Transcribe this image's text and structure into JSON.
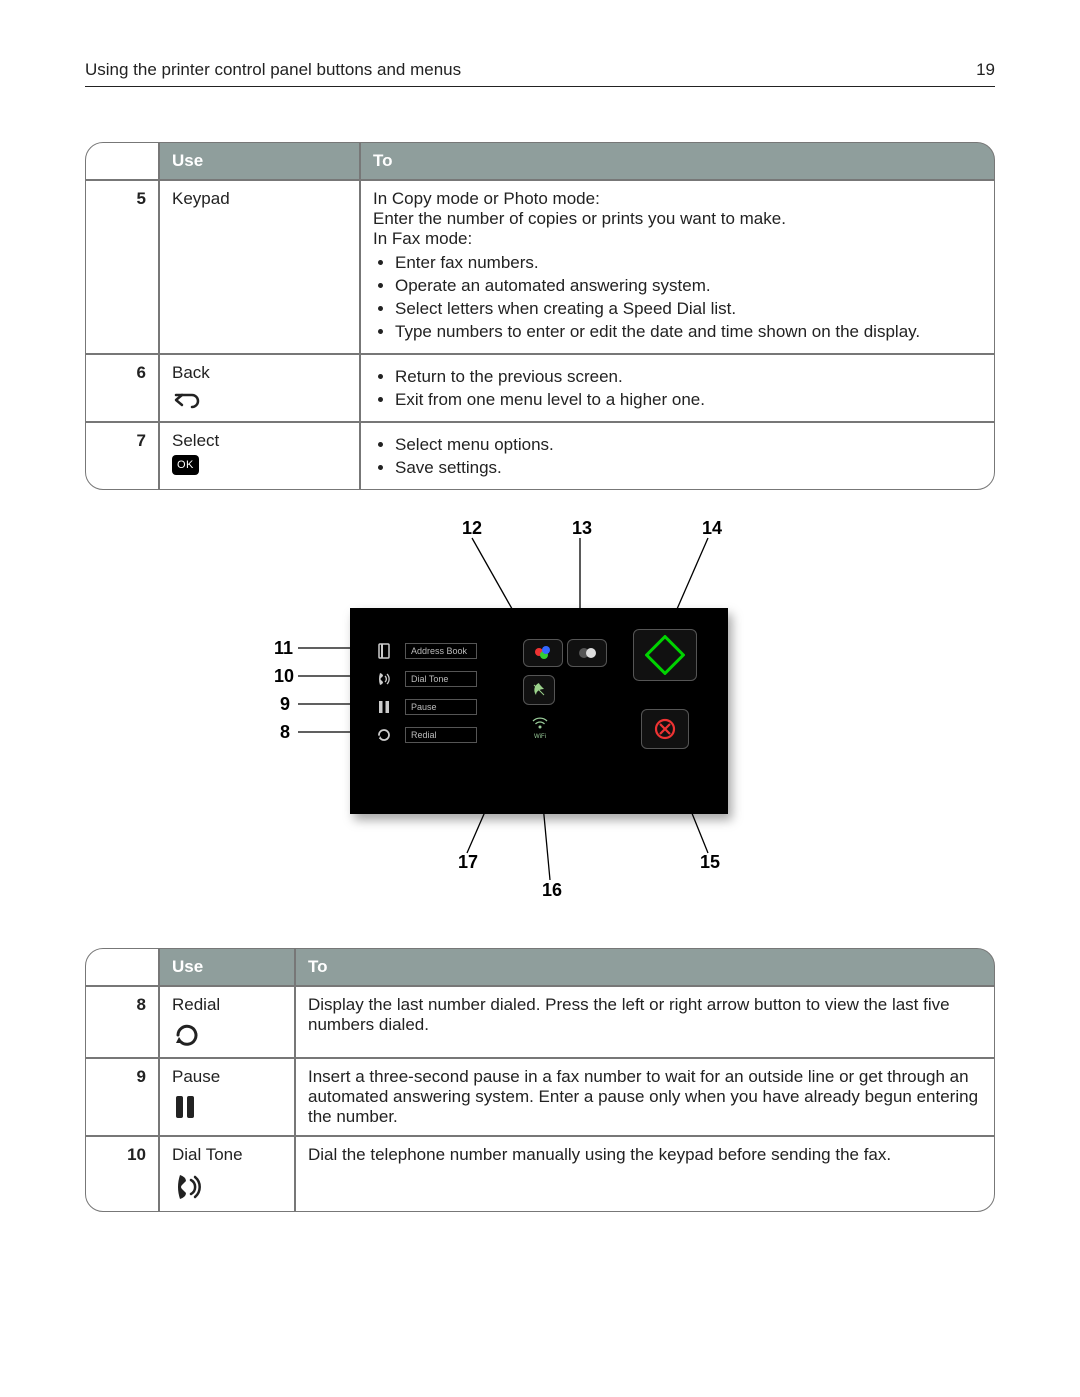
{
  "header": {
    "title": "Using the printer control panel buttons and menus",
    "page": "19"
  },
  "table1": {
    "headers": {
      "use": "Use",
      "to": "To"
    },
    "rows": [
      {
        "num": "5",
        "use": "Keypad",
        "to_lines": [
          "In Copy mode or Photo mode:",
          "Enter the number of copies or prints you want to make.",
          "In Fax mode:"
        ],
        "to_bullets": [
          "Enter fax numbers.",
          "Operate an automated answering system.",
          "Select letters when creating a Speed Dial list.",
          "Type numbers to enter or edit the date and time shown on the display."
        ]
      },
      {
        "num": "6",
        "use": "Back",
        "icon": "back",
        "to_bullets": [
          "Return to the previous screen.",
          "Exit from one menu level to a higher one."
        ]
      },
      {
        "num": "7",
        "use": "Select",
        "icon": "ok",
        "ok_text": "OK",
        "to_bullets": [
          "Select menu options.",
          "Save settings."
        ]
      }
    ]
  },
  "diagram": {
    "menu": [
      {
        "icon": "address-book-icon",
        "label": "Address Book"
      },
      {
        "icon": "dial-tone-icon",
        "label": "Dial Tone"
      },
      {
        "icon": "pause-icon",
        "label": "Pause"
      },
      {
        "icon": "redial-icon",
        "label": "Redial"
      }
    ],
    "wifi_label": "WiFi",
    "callouts": {
      "c8": "8",
      "c9": "9",
      "c10": "10",
      "c11": "11",
      "c12": "12",
      "c13": "13",
      "c14": "14",
      "c15": "15",
      "c16": "16",
      "c17": "17"
    }
  },
  "table2": {
    "headers": {
      "use": "Use",
      "to": "To"
    },
    "rows": [
      {
        "num": "8",
        "use": "Redial",
        "icon": "redial",
        "to": "Display the last number dialed. Press the left or right arrow button to view the last five numbers dialed."
      },
      {
        "num": "9",
        "use": "Pause",
        "icon": "pause",
        "to": "Insert a three-second pause in a fax number to wait for an outside line or get through an automated answering system. Enter a pause only when you have already begun entering the number."
      },
      {
        "num": "10",
        "use": "Dial Tone",
        "icon": "dialtone",
        "to": "Dial the telephone number manually using the keypad before sending the fax."
      }
    ]
  }
}
